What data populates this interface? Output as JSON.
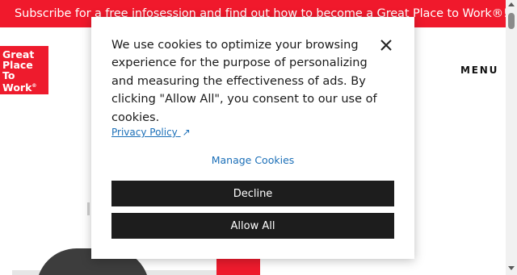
{
  "promo_bar": {
    "text": "Subscribe for a free infosession and find out how to become a Great Place to Work®!"
  },
  "header": {
    "logo_lines": [
      "Great",
      "Place",
      "To",
      "Work"
    ],
    "logo_mark": "®",
    "menu_label": "MENU"
  },
  "cookie_dialog": {
    "message": "We use cookies to optimize your browsing experience for the purpose of personalizing and measuring the effectiveness of ads. By clicking \"Allow All\", you consent to our use of cookies.",
    "privacy_link": "Privacy Policy",
    "privacy_arrow": "↗",
    "manage_link": "Manage Cookies",
    "decline_label": "Decline",
    "allow_label": "Allow All",
    "close_icon": "close-icon"
  },
  "colors": {
    "brand_red": "#ee1b2d",
    "promo_red": "#f0192c",
    "link_blue": "#1b6fb8",
    "button_dark": "#1d1d1d"
  }
}
